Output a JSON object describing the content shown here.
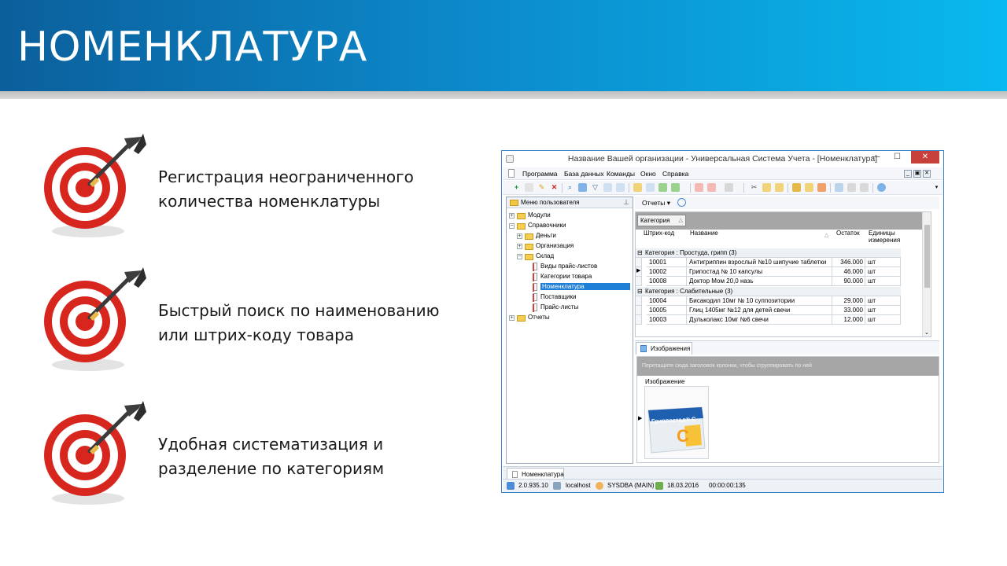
{
  "slide": {
    "title": "НОМЕНКЛАТУРА",
    "bullets": [
      {
        "line1": "Регистрация неограниченного",
        "line2": "количества номенклатуры"
      },
      {
        "line1": "Быстрый поиск по наименованию",
        "line2": "или штрих-коду товара"
      },
      {
        "line1": "Удобная систематизация и",
        "line2": "разделение по категориям"
      }
    ]
  },
  "colors": {
    "header_dark": "#0b5f9b",
    "header_light": "#09b9ef",
    "target_red": "#d7261e",
    "selection": "#1f7fd6"
  },
  "window": {
    "title": "Название Вашей организации - Универсальная Система Учета - [Номенклатура]",
    "controls": {
      "minimize": "—",
      "maximize": "☐",
      "close": "✕"
    },
    "menu": [
      "Программа",
      "База данных",
      "Команды",
      "Окно",
      "Справка"
    ],
    "mdi_controls": [
      "_",
      "▣",
      "✕"
    ],
    "nav": {
      "header": "Меню пользователя",
      "items": [
        {
          "label": "Модули",
          "type": "folder",
          "expander": "+"
        },
        {
          "label": "Справочники",
          "type": "folder",
          "expander": "−"
        },
        {
          "label": "Деньги",
          "type": "folder",
          "expander": "+"
        },
        {
          "label": "Организация",
          "type": "folder",
          "expander": "+"
        },
        {
          "label": "Склад",
          "type": "folder",
          "expander": "−"
        },
        {
          "label": "Виды прайс-листов",
          "type": "doc"
        },
        {
          "label": "Категории товара",
          "type": "doc"
        },
        {
          "label": "Номенклатура",
          "type": "doc",
          "selected": true
        },
        {
          "label": "Поставщики",
          "type": "doc"
        },
        {
          "label": "Прайс-листы",
          "type": "doc"
        },
        {
          "label": "Отчеты",
          "type": "folder",
          "expander": "+"
        }
      ]
    },
    "reports_button": "Отчеты",
    "grid": {
      "group_chip": "Категория",
      "columns": {
        "barcode": "Штрих-код",
        "name": "Название",
        "stock": "Остаток",
        "unit_line1": "Единицы",
        "unit_line2": "измерения"
      },
      "groups": [
        {
          "title": "Категория : Простуда, грипп (3)",
          "rows": [
            {
              "barcode": "10001",
              "name": "Антигриппин взрослый №10 шипучие таблетки",
              "stock": "346.000",
              "unit": "шт"
            },
            {
              "barcode": "10002",
              "name": "Грипостад № 10 капсулы",
              "stock": "46.000",
              "unit": "шт"
            },
            {
              "barcode": "10008",
              "name": "Доктор Мом 20,0 назь",
              "stock": "90.000",
              "unit": "шт"
            }
          ]
        },
        {
          "title": "Категория : Слабительные (3)",
          "rows": [
            {
              "barcode": "10004",
              "name": "Бисакодил 10мг № 10 суппозитории",
              "stock": "29.000",
              "unit": "шт"
            },
            {
              "barcode": "10005",
              "name": "Глиц 1405мг №12 для детей свечи",
              "stock": "33.000",
              "unit": "шт"
            },
            {
              "barcode": "10003",
              "name": "Дульколакс 10мг №6 свечи",
              "stock": "12.000",
              "unit": "шт"
            }
          ]
        }
      ]
    },
    "images_tab": "Изображения",
    "images_grid": {
      "group_hint": "Перетащите сюда заголовок колонки, чтобы сгруппировать по ней",
      "column": "Изображение",
      "product_text": "Гриппостад® С"
    },
    "doc_tab": "Номенклатура",
    "status": {
      "version": "2.0.935.10",
      "host": "localhost",
      "user": "SYSDBA (MAIN)",
      "date": "18.03.2016",
      "timer": "00:00:00:135"
    }
  }
}
